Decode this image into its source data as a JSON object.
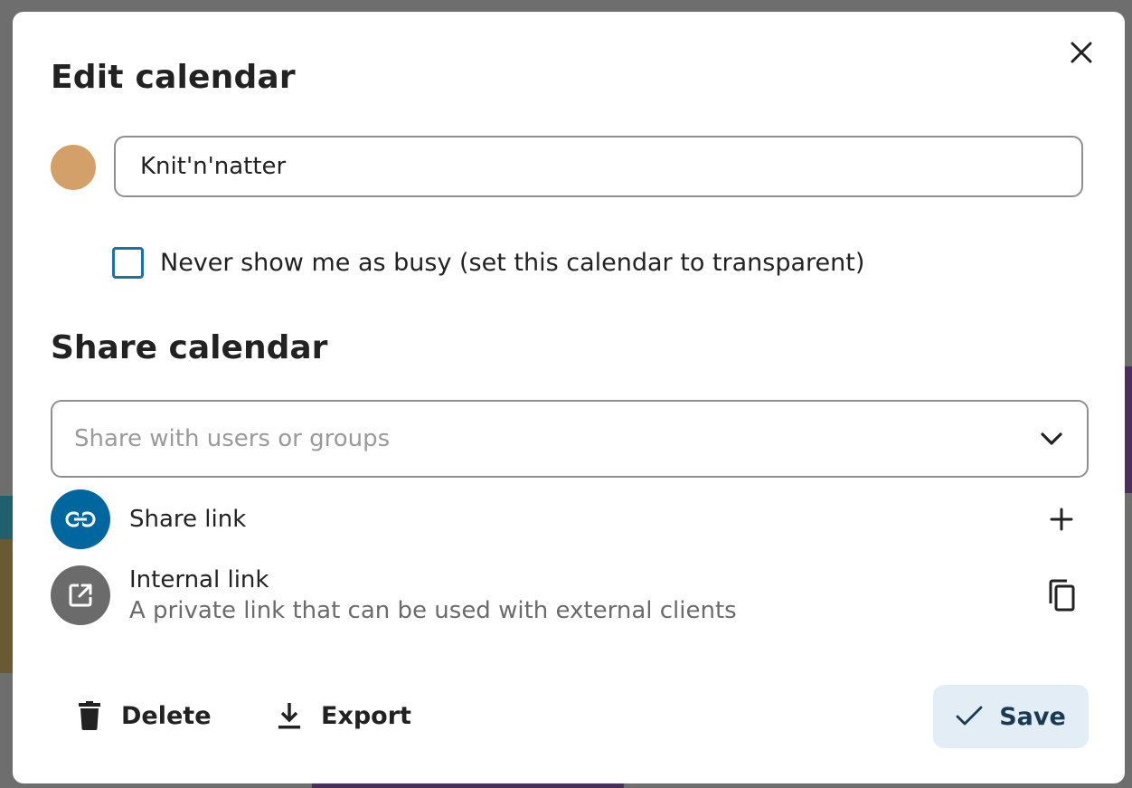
{
  "dialog": {
    "title": "Edit calendar",
    "close_icon": "close-icon"
  },
  "calendar": {
    "color": "#d4a06a",
    "name": "Knit'n'natter",
    "transparent_label": "Never show me as busy (set this calendar to transparent)",
    "transparent_checked": false
  },
  "share": {
    "title": "Share calendar",
    "search_placeholder": "Share with users or groups",
    "share_link": {
      "label": "Share link",
      "icon": "link-icon",
      "action_icon": "plus-icon"
    },
    "internal_link": {
      "label": "Internal link",
      "description": "A private link that can be used with external clients",
      "icon": "open-in-new-icon",
      "action_icon": "copy-icon"
    }
  },
  "footer": {
    "delete_label": "Delete",
    "export_label": "Export",
    "save_label": "Save"
  },
  "colors": {
    "accent": "#00679e",
    "checkbox_border": "#1a73a8",
    "save_bg": "#e3edf6"
  }
}
